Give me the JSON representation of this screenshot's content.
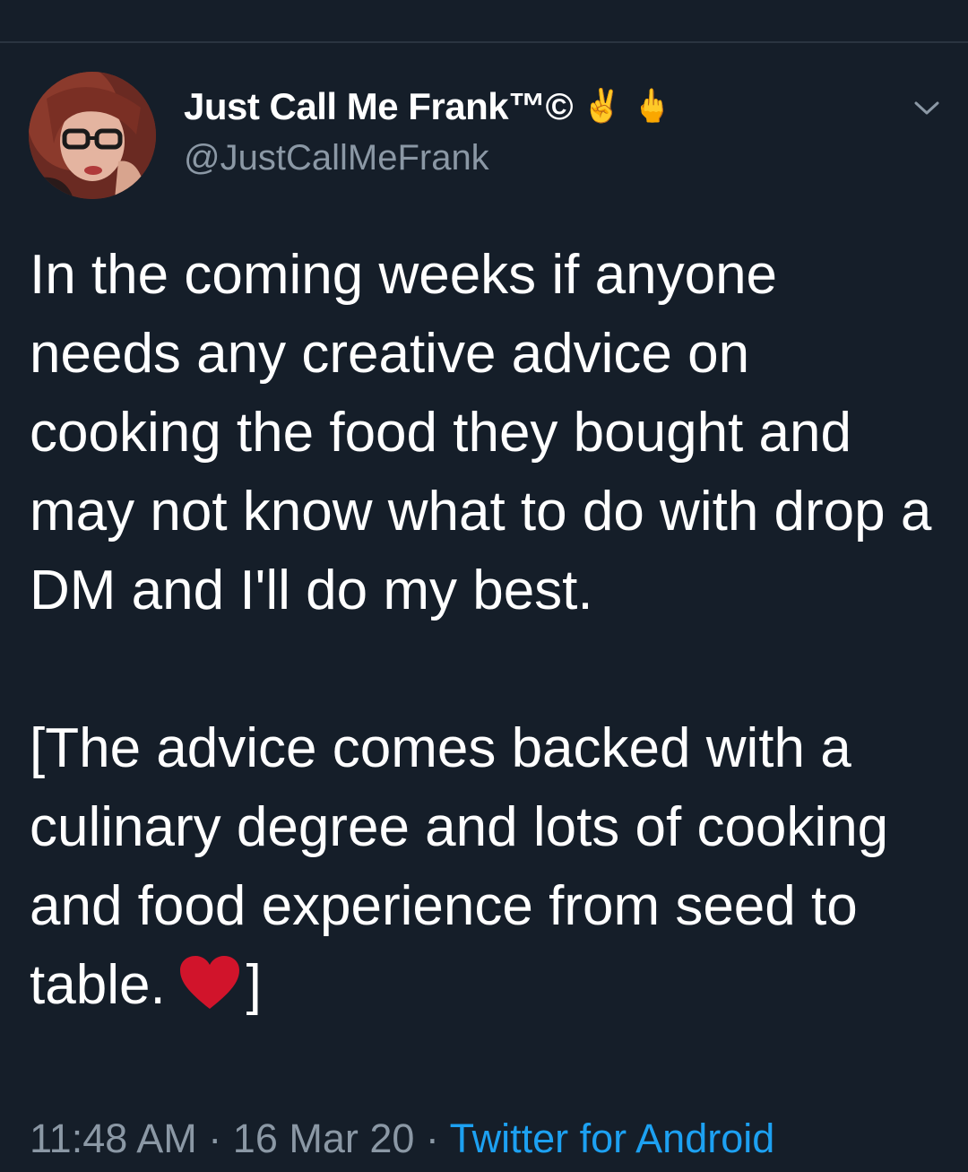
{
  "tweet": {
    "author": {
      "display_name": "Just Call Me Frank™©",
      "emoji": "✌️ 🖕",
      "handle": "@JustCallMeFrank"
    },
    "text_part1": "In the coming weeks if anyone needs any creative advice on cooking the food they bought and may not know what to do with drop a DM and I'll do my best.",
    "text_part2_prefix": "[The advice comes backed with a culinary degree and lots of cooking and food experience from seed to table.",
    "text_part2_suffix": "]",
    "meta": {
      "time": "11:48 AM",
      "separator": " · ",
      "date": "16 Mar 20",
      "source": "Twitter for Android"
    }
  },
  "icons": {
    "chevron": "chevron-down-icon",
    "heart": "red-heart-icon",
    "avatar": "profile-avatar"
  },
  "colors": {
    "background": "#151e29",
    "text": "#ffffff",
    "secondary_text": "#8b98a5",
    "link": "#1da1f2",
    "heart": "#d1142b"
  }
}
